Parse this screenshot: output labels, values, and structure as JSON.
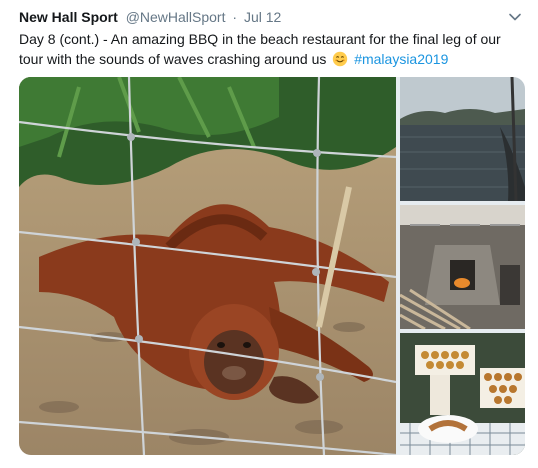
{
  "tweet": {
    "display_name": "New Hall Sport",
    "handle": "@NewHallSport",
    "separator": "·",
    "date": "Jul 12",
    "text_before_emoji": "Day 8 (cont.) - An amazing BBQ in the beach restaurant for the final leg of our tour with the sounds of waves crashing around us",
    "hashtag": "#malaysia2019",
    "emoji_icon": "smiling-face-emoji",
    "hashtag_color": "#1b95e0"
  },
  "media": {
    "photos": [
      {
        "icon": "orangutan-photo"
      },
      {
        "icon": "boat-lake-photo"
      },
      {
        "icon": "bbq-kitchen-photo"
      },
      {
        "icon": "food-platter-photo"
      }
    ]
  }
}
